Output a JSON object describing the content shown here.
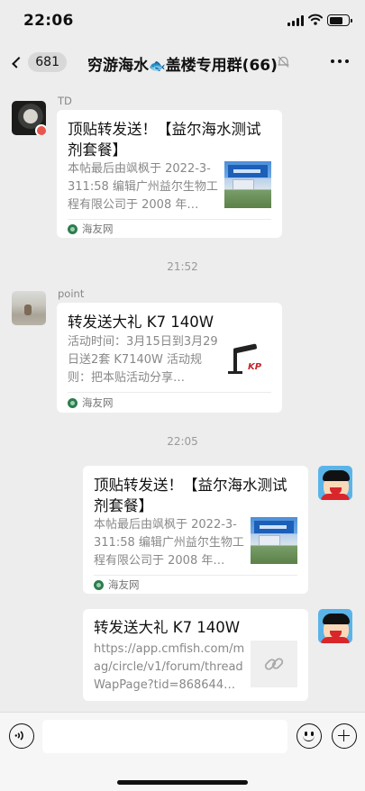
{
  "status_bar": {
    "time": "22:06",
    "icons": [
      "signal-icon",
      "wifi-icon",
      "battery-icon"
    ]
  },
  "nav": {
    "unread_count": "681",
    "title_prefix": "穷游海水",
    "title_emoji": "🐟",
    "title_suffix": "盖楼专用群(66)",
    "icons": [
      "back-chevron-icon",
      "mute-bell-icon",
      "more-icon"
    ]
  },
  "messages": [
    {
      "sender": "TD",
      "card_title": "顶贴转发送！【益尔海水测试剂套餐】",
      "card_desc": "本帖最后由飒枫于 2022-3-311:58 编辑广州益尔生物工程有限公司于 2008 年…",
      "source": "海友网"
    },
    {
      "sender": "point",
      "card_title": "转发送大礼  K7 140W",
      "card_desc": "活动时间：3月15日到3月29日送2套 K7140W 活动规则：把本贴活动分享…",
      "source": "海友网"
    },
    {
      "sender": "",
      "card_title": "顶贴转发送！【益尔海水测试剂套餐】",
      "card_desc": "本帖最后由飒枫于 2022-3-311:58 编辑广州益尔生物工程有限公司于 2008 年…",
      "source": "海友网"
    },
    {
      "sender": "",
      "card_title": "转发送大礼 K7 140W",
      "card_desc": "https://app.cmfish.com/mag/circle/v1/forum/threadWapPage?tid=868644…",
      "source": ""
    }
  ],
  "timestamps": [
    "21:52",
    "22:05"
  ],
  "thumb_texts": {
    "lamp_logo": "KP"
  },
  "colors": {
    "chat_background": "#EDEDED",
    "card_background": "#FFFFFF",
    "muted_text": "#888888",
    "source_icon": "#2D7C4F"
  }
}
